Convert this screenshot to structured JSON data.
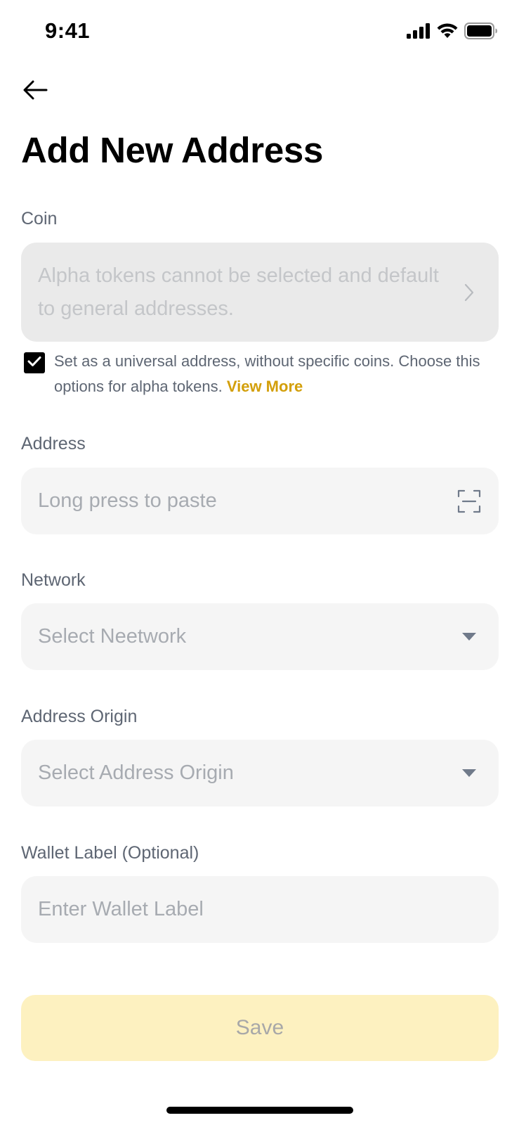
{
  "status_bar": {
    "time": "9:41"
  },
  "header": {
    "back_icon": "arrow-left-icon",
    "title": "Add New Address"
  },
  "coin": {
    "label": "Coin",
    "placeholder": "Alpha tokens cannot be selected and default to general addresses.",
    "icon": "chevron-right-icon",
    "disabled": true
  },
  "universal": {
    "checked": true,
    "text": "Set as a universal address, without specific coins. Choose this options for alpha tokens. ",
    "link": "View More"
  },
  "address": {
    "label": "Address",
    "placeholder": "Long press to paste",
    "icon": "scan-icon"
  },
  "network": {
    "label": "Network",
    "placeholder": "Select Neetwork",
    "icon": "caret-down-icon"
  },
  "origin": {
    "label": "Address Origin",
    "placeholder": "Select Address Origin",
    "icon": "caret-down-icon"
  },
  "wallet_label": {
    "label": "Wallet Label (Optional)",
    "placeholder": "Enter Wallet Label"
  },
  "save": {
    "label": "Save",
    "enabled": false
  },
  "colors": {
    "accent": "#d39f0a",
    "save_disabled_bg": "#fdf1c0",
    "field_bg": "#f5f5f5",
    "placeholder": "#a7abb1"
  }
}
